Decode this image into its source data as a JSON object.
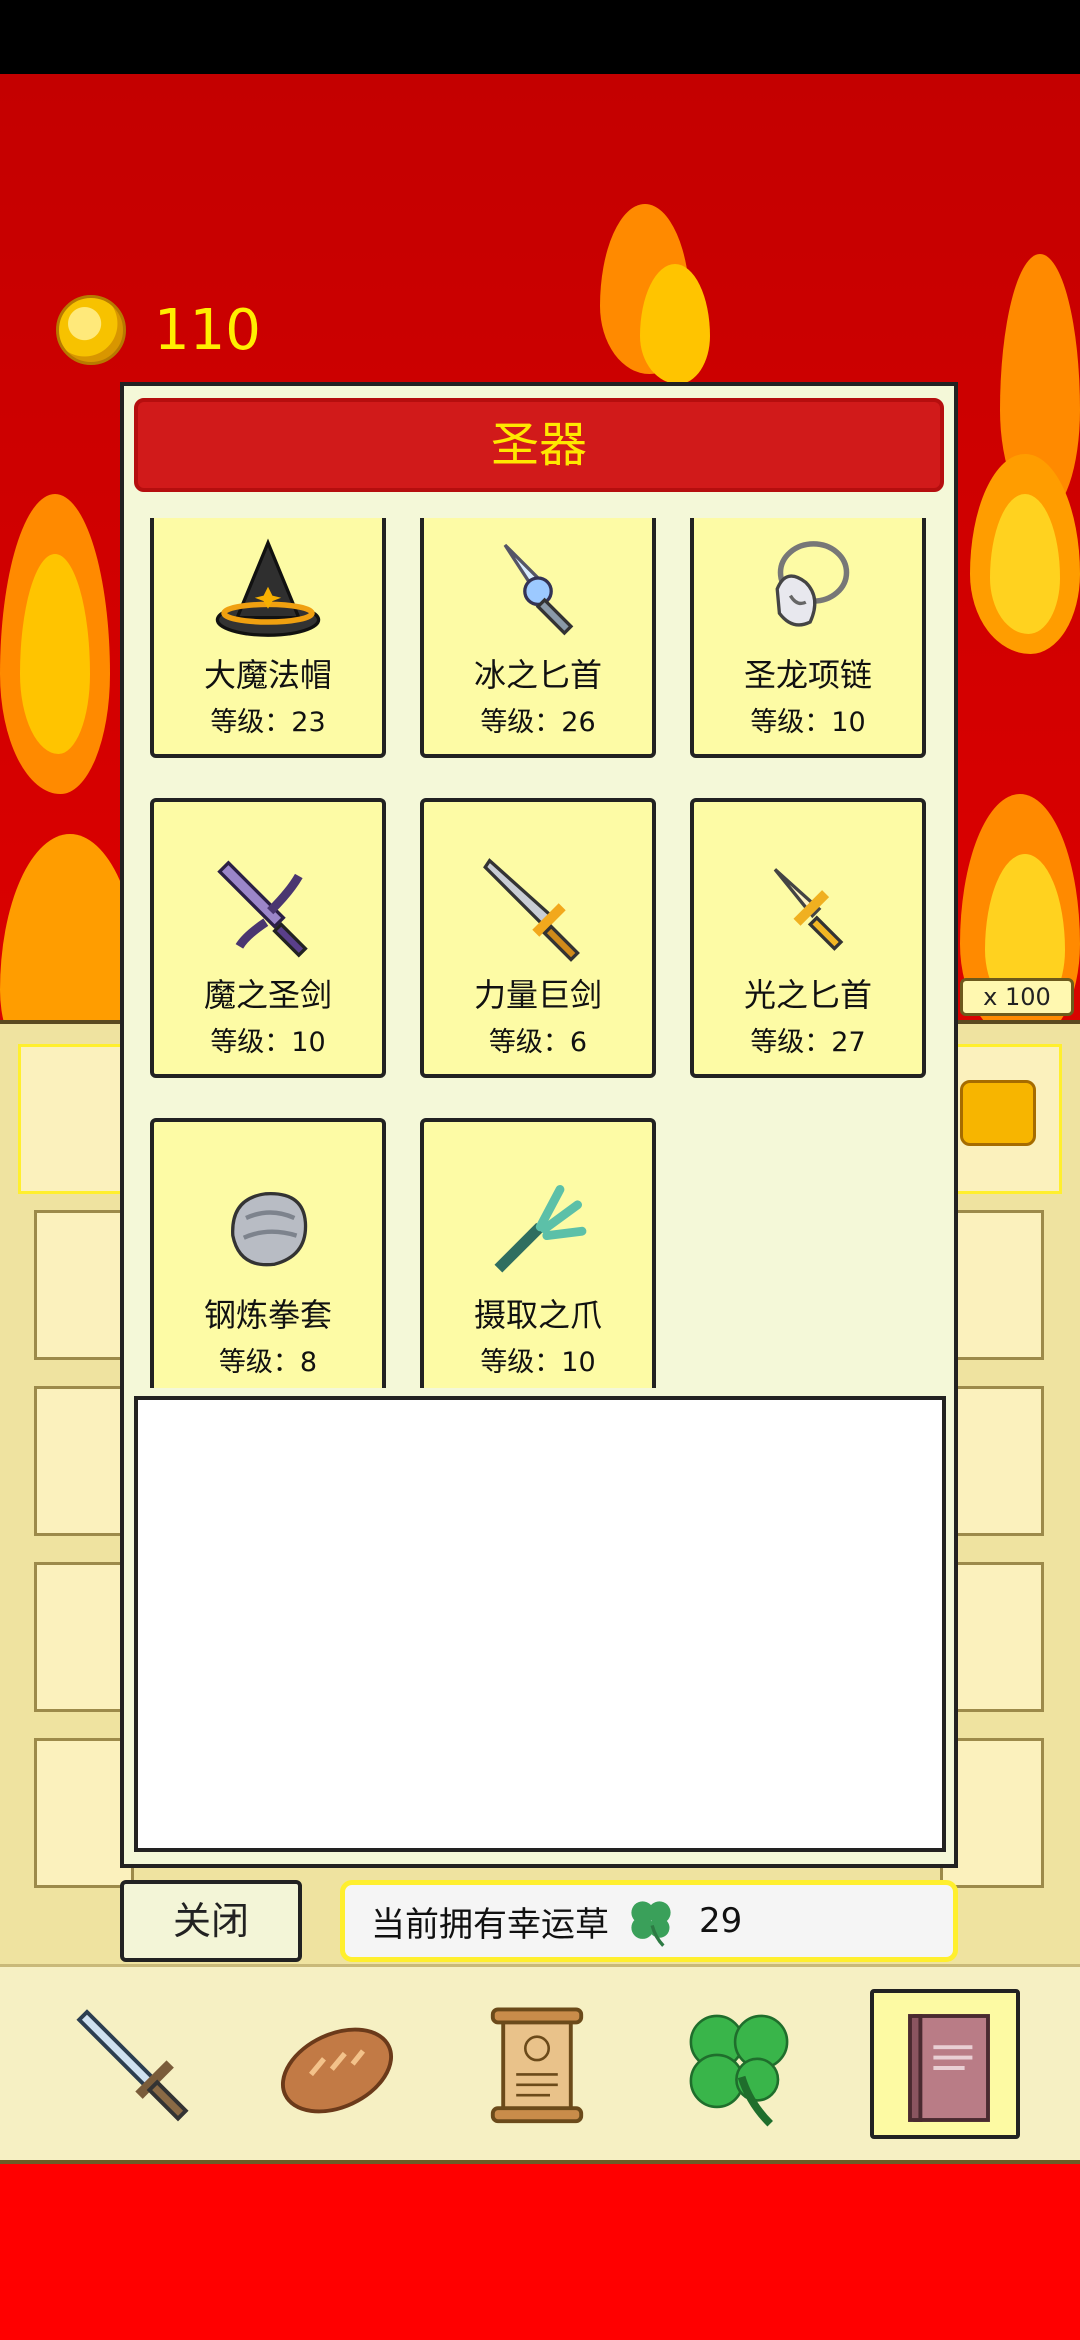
{
  "gold": {
    "value": "110"
  },
  "dialog": {
    "title": "圣器",
    "items": [
      {
        "name": "大魔法帽",
        "level": "等级：23",
        "icon": "wizard-hat-icon"
      },
      {
        "name": "冰之匕首",
        "level": "等级：26",
        "icon": "ice-dagger-icon"
      },
      {
        "name": "圣龙项链",
        "level": "等级：10",
        "icon": "dragon-necklace-icon"
      },
      {
        "name": "魔之圣剑",
        "level": "等级：10",
        "icon": "demon-sword-icon"
      },
      {
        "name": "力量巨剑",
        "level": "等级：6",
        "icon": "great-sword-icon"
      },
      {
        "name": "光之匕首",
        "level": "等级：27",
        "icon": "light-dagger-icon"
      },
      {
        "name": "钢炼拳套",
        "level": "等级：8",
        "icon": "steel-gauntlet-icon"
      },
      {
        "name": "摄取之爪",
        "level": "等级：10",
        "icon": "claw-icon"
      }
    ]
  },
  "footer": {
    "close_label": "关闭",
    "clover_label": "当前拥有幸运草",
    "clover_count": "29"
  },
  "background": {
    "multiplier": "x 100"
  },
  "nav": [
    "sword-icon",
    "bread-icon",
    "scroll-icon",
    "clover-icon",
    "book-icon"
  ],
  "colors": {
    "title_bg": "#d11a1a",
    "title_text": "#ffe800",
    "card_bg": "#fdfba5",
    "gold_text": "#ffee00"
  }
}
